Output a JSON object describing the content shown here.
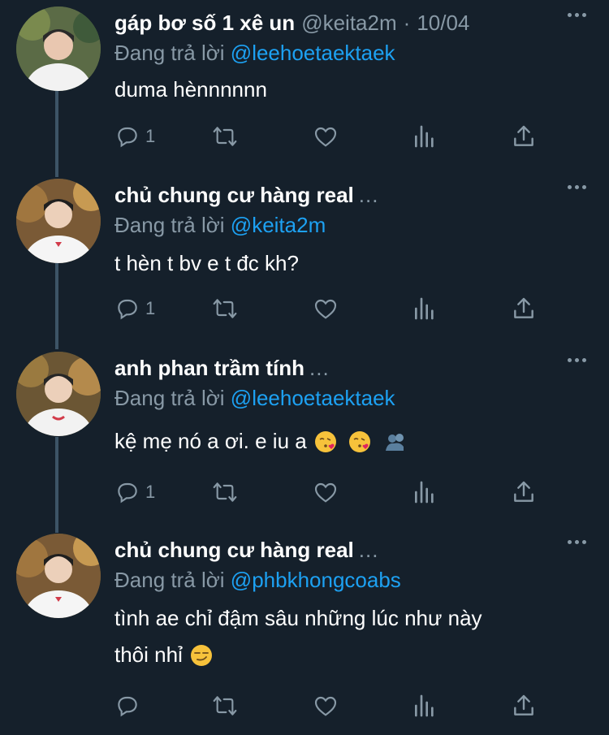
{
  "tweets": [
    {
      "name": "gáp bơ số 1 xê un",
      "handle": "@keita2m",
      "separator": "·",
      "date": "10/04",
      "reply_prefix": "Đang trả lời",
      "reply_to": "@leehoetaektaek",
      "text": "duma hènnnnnn",
      "reply_count": "1"
    },
    {
      "name": "chủ chung cư hàng real",
      "ellipsis": "...",
      "reply_prefix": "Đang trả lời",
      "reply_to": "@keita2m",
      "text": "t hèn t bv e t đc kh?",
      "reply_count": "1"
    },
    {
      "name": "anh phan trầm tính",
      "ellipsis": "...",
      "reply_prefix": "Đang trả lời",
      "reply_to": "@leehoetaektaek",
      "text": "kệ mẹ nó a ơi. e iu a",
      "reply_count": "1"
    },
    {
      "name": "chủ chung cư hàng real",
      "ellipsis": "...",
      "reply_prefix": "Đang trả lời",
      "reply_to": "@phbkhongcoabs",
      "text_line1": "tình ae chỉ đậm sâu những lúc như này",
      "text_line2": "thôi nhỉ",
      "reply_count": ""
    }
  ],
  "icons": {
    "reply": "reply-icon",
    "retweet": "retweet-icon",
    "like": "heart-icon",
    "analytics": "analytics-icon",
    "share": "share-icon",
    "more": "more-icon"
  },
  "colors": {
    "background": "#15202b",
    "link": "#1da1f2",
    "muted": "#8899a6",
    "thread_line": "#3d5466"
  }
}
